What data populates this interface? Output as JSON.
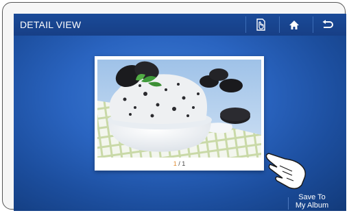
{
  "header": {
    "title": "DETAIL VIEW"
  },
  "toolbar": {
    "buttons": [
      {
        "icon": "doc-hand-icon"
      },
      {
        "icon": "home-icon"
      },
      {
        "icon": "back-arrow-icon"
      }
    ]
  },
  "viewer": {
    "current_page": "1",
    "page_separator": " / ",
    "total_pages": "1",
    "photo_subject": "cookies-and-cream ice cream"
  },
  "actions": {
    "save_line1": "Save To",
    "save_line2": "My Album"
  },
  "colors": {
    "title_bar": "#173f86",
    "screen_center": "#3f7ed6",
    "screen_edge": "#123a7a",
    "page_accent": "#e08a2e"
  }
}
